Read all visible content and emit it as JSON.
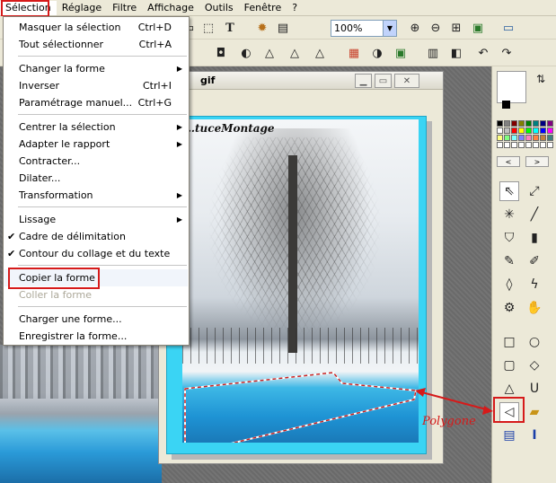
{
  "menubar": {
    "items": [
      "Sélection",
      "Réglage",
      "Filtre",
      "Affichage",
      "Outils",
      "Fenêtre",
      "?"
    ]
  },
  "toolbar": {
    "zoom_value": "100%"
  },
  "image_window": {
    "title": "gif",
    "caption": "…tuceMontage"
  },
  "menu": {
    "items": [
      {
        "label": "Masquer la sélection",
        "shortcut": "Ctrl+D"
      },
      {
        "label": "Tout sélectionner",
        "shortcut": "Ctrl+A"
      },
      {
        "label": "Changer la forme"
      },
      {
        "label": "Inverser",
        "shortcut": "Ctrl+I"
      },
      {
        "label": "Paramétrage manuel...",
        "shortcut": "Ctrl+G"
      },
      {
        "label": "Centrer la sélection"
      },
      {
        "label": "Adapter le rapport"
      },
      {
        "label": "Contracter..."
      },
      {
        "label": "Dilater..."
      },
      {
        "label": "Transformation"
      },
      {
        "label": "Lissage"
      },
      {
        "label": "Cadre de délimitation"
      },
      {
        "label": "Contour du collage et du texte"
      },
      {
        "label": "Copier la forme"
      },
      {
        "label": "Coller la forme"
      },
      {
        "label": "Charger une forme..."
      },
      {
        "label": "Enregistrer la forme..."
      }
    ]
  },
  "annotation": {
    "label": "Polygone"
  },
  "colors": {
    "accent": "#d61a1a",
    "frame": "#3ad4f4"
  }
}
